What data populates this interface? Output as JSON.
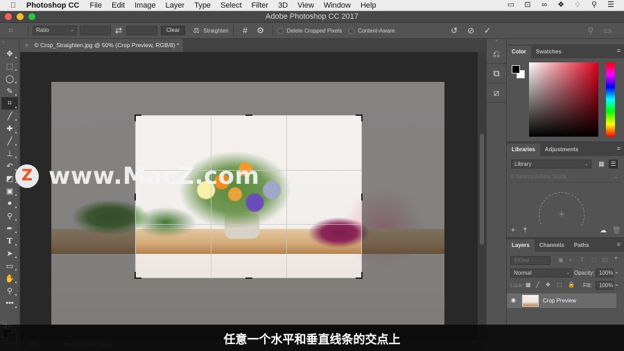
{
  "menubar": {
    "apple_icon": "apple-icon",
    "app_name": "Photoshop CC",
    "items": [
      "File",
      "Edit",
      "Image",
      "Layer",
      "Type",
      "Select",
      "Filter",
      "3D",
      "View",
      "Window",
      "Help"
    ],
    "status_icons": [
      "display-icon",
      "screen-record-icon",
      "creative-cloud-icon",
      "dropbox-icon",
      "wifi-icon",
      "spotlight-search-icon",
      "notification-list-icon"
    ]
  },
  "window": {
    "title": "Adobe Photoshop CC 2017"
  },
  "options_bar": {
    "ratio_select": "Ratio",
    "width_value": "",
    "height_value": "",
    "clear_label": "Clear",
    "straighten_label": "Straighten",
    "delete_cropped_label": "Delete Cropped Pixels",
    "delete_cropped_checked": false,
    "content_aware_label": "Content-Aware",
    "content_aware_checked": false
  },
  "document": {
    "tab_title": "© Crop_Straighten.jpg @ 50% (Crop Preview, RGB/8) *",
    "zoom": "50%",
    "doc_info": "Doc: 19.8M/0 bytes"
  },
  "tools": [
    "move-tool",
    "marquee-tool",
    "lasso-tool",
    "quick-selection-tool",
    "crop-tool",
    "eyedropper-tool",
    "healing-brush-tool",
    "brush-tool",
    "clone-stamp-tool",
    "history-brush-tool",
    "eraser-tool",
    "gradient-tool",
    "blur-tool",
    "dodge-tool",
    "pen-tool",
    "type-tool",
    "path-selection-tool",
    "rectangle-tool",
    "hand-tool",
    "zoom-tool",
    "more-tools"
  ],
  "active_tool": "crop-tool",
  "colors": {
    "foreground": "#000000",
    "background": "#ffffff",
    "accent_red": "#e0001b"
  },
  "color_panel": {
    "tabs": [
      "Color",
      "Swatches"
    ],
    "active_tab": "Color"
  },
  "libraries_panel": {
    "tabs": [
      "Libraries",
      "Adjustments"
    ],
    "active_tab": "Libraries",
    "library_select": "Library",
    "search_placeholder": "Search Adobe Stock"
  },
  "layers_panel": {
    "tabs": [
      "Layers",
      "Channels",
      "Paths"
    ],
    "active_tab": "Layers",
    "filter_placeholder": "Kind",
    "blend_mode": "Normal",
    "opacity_label": "Opacity:",
    "opacity_value": "100%",
    "lock_label": "Lock:",
    "fill_label": "Fill:",
    "fill_value": "100%",
    "layers": [
      {
        "name": "Crop Preview",
        "visible": true
      }
    ]
  },
  "overlay": {
    "watermark_logo": "Z",
    "watermark_text": "www.MacZ.com",
    "subtitle": "任意一个水平和垂直线条的交点上"
  }
}
